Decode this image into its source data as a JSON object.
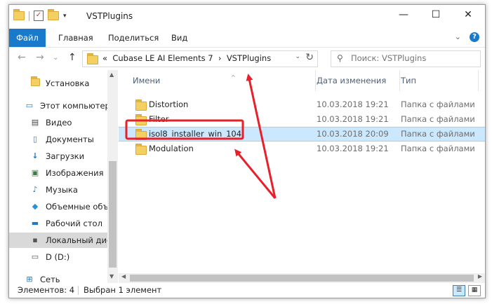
{
  "window": {
    "title": "VSTPlugins",
    "controls": {
      "minimize": "—",
      "maximize": "☐",
      "close": "✕"
    }
  },
  "ribbon": {
    "tabs": [
      "Файл",
      "Главная",
      "Поделиться",
      "Вид"
    ],
    "expand": "⌄",
    "help": "?"
  },
  "navigation": {
    "back": "←",
    "forward": "→",
    "recent": "⌄",
    "up": "↑",
    "address": {
      "overflow": "«",
      "parent": "Cubase LE AI Elements 7",
      "separator": "›",
      "current": "VSTPlugins",
      "dropdown": "⌄",
      "refresh": "↻"
    },
    "search": {
      "icon": "⚲",
      "placeholder": "Поиск: VSTPlugins"
    }
  },
  "sidebar": {
    "items": [
      {
        "label": "Установка",
        "icon": "folder-icon"
      },
      {
        "label": "Этот компьютер",
        "icon": "computer-icon"
      },
      {
        "label": "Видео",
        "icon": "video-icon"
      },
      {
        "label": "Документы",
        "icon": "documents-icon"
      },
      {
        "label": "Загрузки",
        "icon": "downloads-icon"
      },
      {
        "label": "Изображения",
        "icon": "pictures-icon"
      },
      {
        "label": "Музыка",
        "icon": "music-icon"
      },
      {
        "label": "Объемные объ",
        "icon": "3d-objects-icon"
      },
      {
        "label": "Рабочий стол",
        "icon": "desktop-icon"
      },
      {
        "label": "Локальный дис",
        "icon": "local-disk-icon"
      },
      {
        "label": "D (D:)",
        "icon": "drive-icon"
      },
      {
        "label": "Сеть",
        "icon": "network-icon"
      }
    ]
  },
  "table": {
    "columns": [
      "Имени",
      "Дата изменения",
      "Тип"
    ],
    "sort_arrow": "^",
    "rows": [
      {
        "name": "Distortion",
        "date": "10.03.2018 19:21",
        "type": "Папка с файлами"
      },
      {
        "name": "Filter",
        "date": "10.03.2018 19:21",
        "type": "Папка с файлами"
      },
      {
        "name": "isol8_installer_win_104",
        "date": "10.03.2018 20:09",
        "type": "Папка с файлами"
      },
      {
        "name": "Modulation",
        "date": "10.03.2018 19:21",
        "type": "Папка с файлами"
      }
    ]
  },
  "status": {
    "count": "Элементов: 4",
    "selection": "Выбран 1 элемент"
  },
  "colors": {
    "accent": "#1979ca",
    "selection": "#cce8ff",
    "annotation": "#e8202a"
  }
}
